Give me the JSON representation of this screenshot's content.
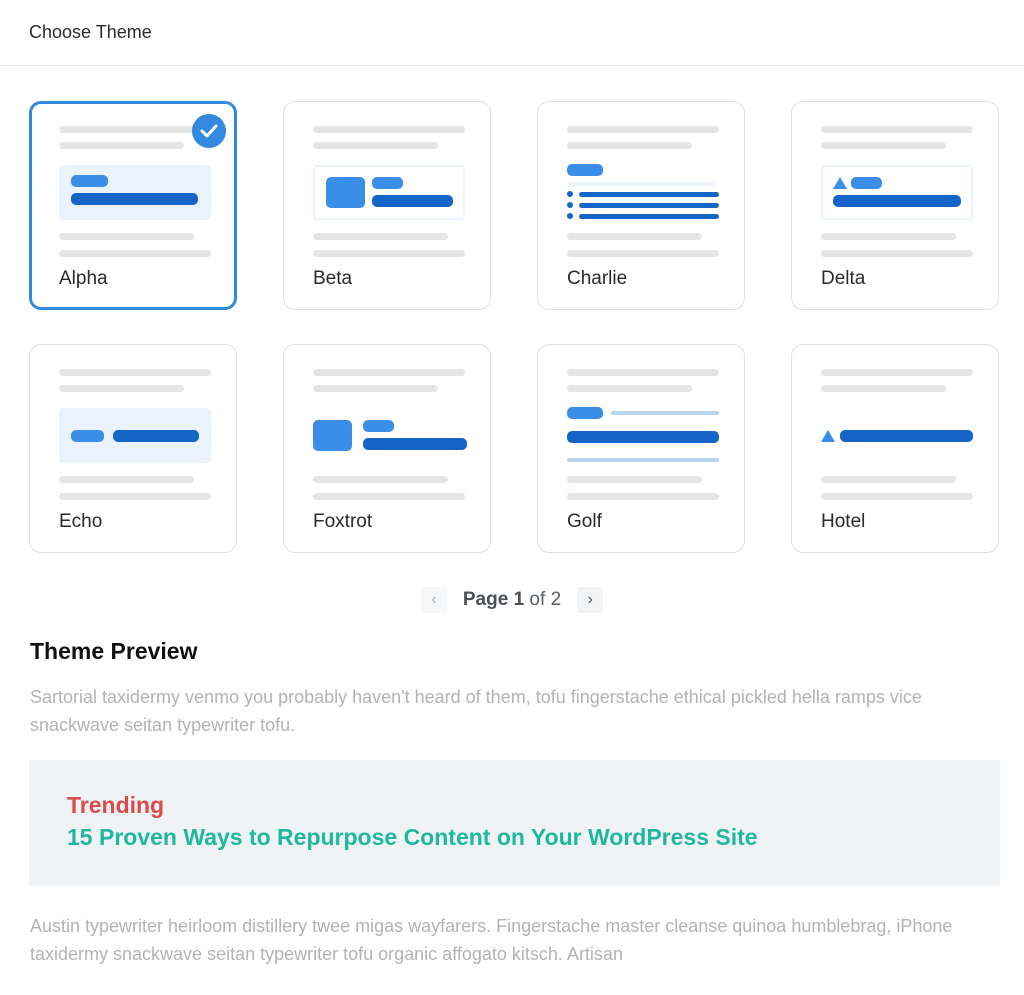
{
  "header": {
    "title": "Choose Theme"
  },
  "themes": [
    {
      "name": "Alpha",
      "selected": true,
      "layout": "panel-pill-bar"
    },
    {
      "name": "Beta",
      "selected": false,
      "layout": "outlined-square-pill-bar"
    },
    {
      "name": "Charlie",
      "selected": false,
      "layout": "pill-bulleted-list"
    },
    {
      "name": "Delta",
      "selected": false,
      "layout": "outlined-triangle-pill-bar"
    },
    {
      "name": "Echo",
      "selected": false,
      "layout": "panel-inline-pill-bar"
    },
    {
      "name": "Foxtrot",
      "selected": false,
      "layout": "square-pill-bar"
    },
    {
      "name": "Golf",
      "selected": false,
      "layout": "pill-rule-bar-rule"
    },
    {
      "name": "Hotel",
      "selected": false,
      "layout": "triangle-bar"
    }
  ],
  "icons": {
    "selected": "check-circle-icon",
    "prev": "chevron-left-icon",
    "next": "chevron-right-icon"
  },
  "pagination": {
    "prefix": "Page",
    "current": "1",
    "of_label": "of",
    "total": "2",
    "prev_label": "‹",
    "next_label": "›"
  },
  "preview": {
    "title": "Theme Preview",
    "intro": "Sartorial taxidermy venmo you probably haven't heard of them, tofu fingerstache ethical pickled hella ramps vice snackwave seitan typewriter tofu.",
    "trending_label": "Trending",
    "trending_headline": "15 Proven Ways to Repurpose Content on Your WordPress Site",
    "body": "Austin typewriter heirloom distillery twee migas wayfarers. Fingerstache master cleanse quinoa humblebrag, iPhone taxidermy snackwave seitan typewriter tofu organic affogato kitsch. Artisan"
  },
  "colors": {
    "accent": "#3388e0",
    "accent_dark": "#1565c8",
    "trending": "#dc4b4b",
    "headline": "#1fb89c"
  }
}
